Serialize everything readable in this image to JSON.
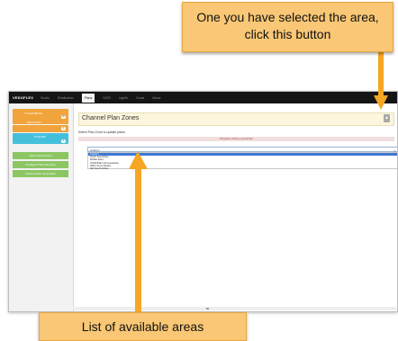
{
  "callouts": {
    "top": "One you have selected the area, click this button",
    "bottom": "List of available areas"
  },
  "colors": {
    "arrow": "#f5a623",
    "nav_bg": "#151515",
    "accent_orange": "#f2a43c",
    "accent_blue": "#45c0dc",
    "accent_green": "#8cc663",
    "header_bg": "#fbf6dd",
    "warning_bg": "#f0dede",
    "select_highlight": "#3e78d3"
  },
  "app": {
    "logo": "VEDOFLEX",
    "nav": [
      "Sinals",
      "Sinalisation",
      "Plans",
      "SICR",
      "Lignith",
      "Canal",
      "About"
    ],
    "active_tab": "Plans"
  },
  "sidebar": {
    "box1_label": "TX ELIGIBLES",
    "box1_badge": "88",
    "box2_label": "NEW PLAN",
    "box2_badge": "0",
    "box3_label": "SYSTEM",
    "box3_badge": "0",
    "buttons": [
      "New Channel Plan",
      "Configure Plans By Zone",
      "Channel Plan Generation"
    ]
  },
  "main": {
    "title": "Channel Plan Zones",
    "header_button": "▲",
    "help_text": "Select Plan Zone to update plans.",
    "warning": "Old plans will be overwritten",
    "select_value": "Custom",
    "options": [
      "Custom",
      "North Sea Africa",
      "Middle East",
      "UKRAINE-Indonesia/Asia",
      "WRC Zone Radius",
      "IEA South Africa"
    ],
    "selected_index": 0
  }
}
